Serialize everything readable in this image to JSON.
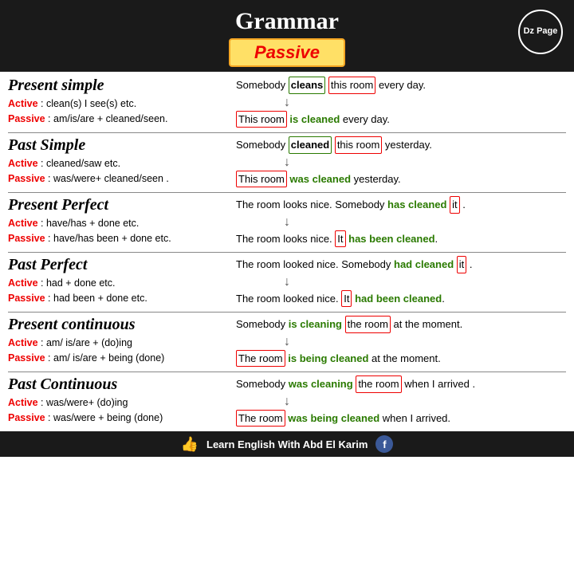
{
  "header": {
    "title": "Grammar",
    "passive_label": "Passive",
    "dz_page": "Dz Page"
  },
  "sections": [
    {
      "id": "present-simple",
      "title": "Present simple",
      "active_rule": "Active : clean(s) I see(s) etc.",
      "passive_rule": "Passive : am/is/are + cleaned/seen.",
      "example_active": "Somebody cleans this room every day.",
      "example_passive": "This room is cleaned every day."
    },
    {
      "id": "past-simple",
      "title": "Past Simple",
      "active_rule": "Active : cleaned/saw etc.",
      "passive_rule": "Passive : was/were+ cleaned/seen .",
      "example_active": "Somebody cleaned this room yesterday.",
      "example_passive": "This room was cleaned yesterday."
    },
    {
      "id": "present-perfect",
      "title": "Present Perfect",
      "active_rule": "Active :  have/has + done etc.",
      "passive_rule": "Passive : have/has been + done etc.",
      "example_active": "The room looks nice. Somebody has cleaned it .",
      "example_passive": "The room looks nice. It has been cleaned."
    },
    {
      "id": "past-perfect",
      "title": "Past Perfect",
      "active_rule": "Active : had + done etc.",
      "passive_rule": "Passive : had been + done etc.",
      "example_active": "The room looked nice. Somebody had cleaned it .",
      "example_passive": "The room looked nice. It had been cleaned."
    },
    {
      "id": "present-continuous",
      "title": "Present continuous",
      "active_rule": "Active : am/ is/are + (do)ing",
      "passive_rule": "Passive : am/ is/are + being (done)",
      "example_active": "Somebody is cleaning the room at the moment.",
      "example_passive": "The room is being cleaned at the moment."
    },
    {
      "id": "past-continuous",
      "title": "Past Continuous",
      "active_rule": "Active : was/were+ (do)ing",
      "passive_rule": "Passive : was/were + being (done)",
      "example_active": "Somebody was cleaning the room when I arrived .",
      "example_passive": "The room was being cleaned when I arrived."
    }
  ],
  "footer": {
    "text": "Learn English With Abd El Karim",
    "fb_letter": "f"
  }
}
